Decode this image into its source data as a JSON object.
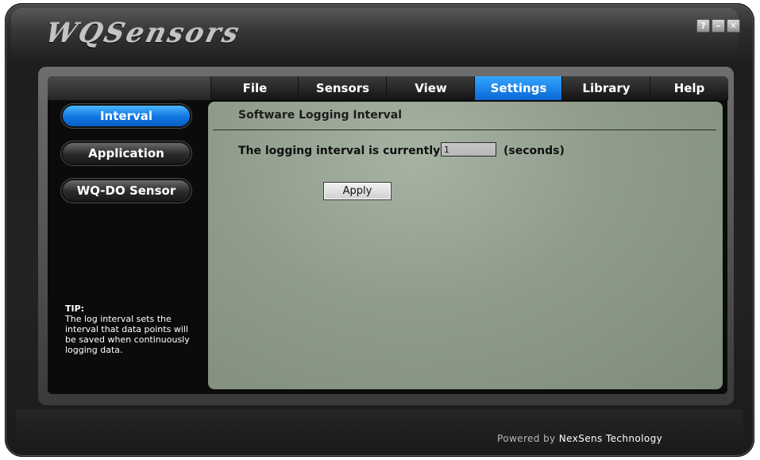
{
  "app": {
    "logo_text": "WQSensors",
    "window_controls": {
      "help": "?",
      "minimize": "–",
      "close": "✕"
    }
  },
  "menu": {
    "items": [
      {
        "label": "File",
        "active": false
      },
      {
        "label": "Sensors",
        "active": false
      },
      {
        "label": "View",
        "active": false
      },
      {
        "label": "Settings",
        "active": true
      },
      {
        "label": "Library",
        "active": false
      },
      {
        "label": "Help",
        "active": false
      }
    ]
  },
  "sidebar": {
    "items": [
      {
        "label": "Interval",
        "active": true
      },
      {
        "label": "Application",
        "active": false
      },
      {
        "label": "WQ-DO Sensor",
        "active": false
      }
    ],
    "tip_title": "TIP:",
    "tip_text": "The log interval sets the interval that data points will be saved when continuously logging data."
  },
  "main": {
    "title": "Software Logging Interval",
    "interval_label": "The logging interval is currently",
    "interval_value": "1",
    "interval_unit": "(seconds)",
    "apply_label": "Apply"
  },
  "footer": {
    "prefix": "Powered by",
    "brand": "NexSens Technology"
  },
  "colors": {
    "accent": "#1a86f0",
    "panel": "#919e8d",
    "skin": "#222222"
  }
}
